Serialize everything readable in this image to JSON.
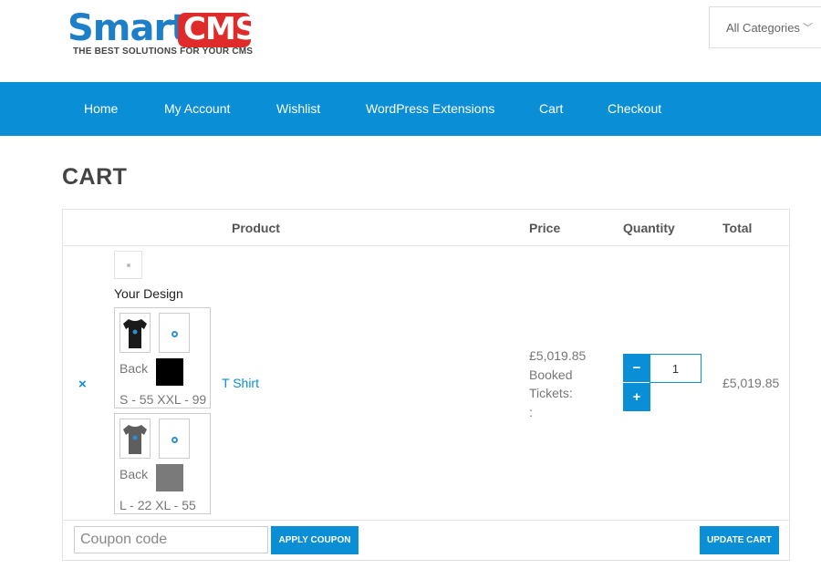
{
  "header": {
    "logo_smart": "Smart",
    "logo_cms": "CMS",
    "logo_tagline": "THE BEST SOLUTIONS FOR YOUR CMS",
    "category_select": "All Categories"
  },
  "nav": {
    "items": [
      "Home",
      "My Account",
      "Wishlist",
      "WordPress Extensions",
      "Cart",
      "Checkout"
    ]
  },
  "page": {
    "title": "CART"
  },
  "table": {
    "headers": {
      "product": "Product",
      "price": "Price",
      "quantity": "Quantity",
      "total": "Total"
    }
  },
  "cart_item": {
    "remove_icon": "×",
    "your_design_label": "Your Design",
    "designs": [
      {
        "side": "Back",
        "swatch_color": "#000000",
        "shirt_color": "#1a1a1a",
        "sizes": "S - 55 XXL - 99"
      },
      {
        "side": "Back",
        "swatch_color": "#7a7a7a",
        "shirt_color": "#5e5e5e",
        "sizes": "L - 22 XL - 55"
      }
    ],
    "product_name": "T Shirt",
    "price": "£5,019.85",
    "booked_label": "Booked",
    "tickets_label": "Tickets:",
    "tickets_value": ":",
    "qty_minus": "−",
    "qty_plus": "+",
    "quantity": "1",
    "total": "£5,019.85"
  },
  "footer": {
    "coupon_placeholder": "Coupon code",
    "apply_coupon": "APPLY COUPON",
    "update_cart": "UPDATE CART"
  },
  "colors": {
    "accent": "#0a8fd6",
    "logo_red": "#e02b2b",
    "logo_blue": "#1e7fc9"
  }
}
